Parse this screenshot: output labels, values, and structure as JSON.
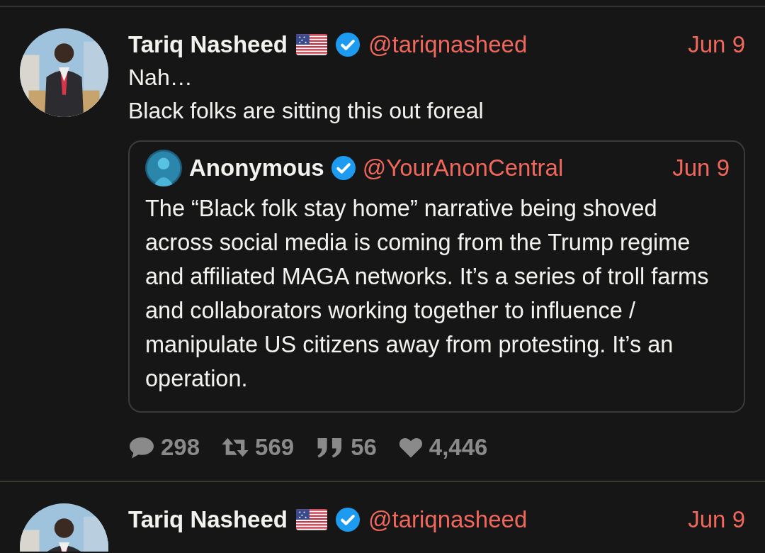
{
  "tweets": [
    {
      "author": {
        "name": "Tariq Nasheed",
        "flag": true,
        "verified": true,
        "handle": "@tariqnasheed"
      },
      "date": "Jun 9",
      "text": [
        "Nah…",
        "Black folks are sitting this out foreal"
      ],
      "quote": {
        "author": {
          "name": "Anonymous",
          "verified": true,
          "handle": "@YourAnonCentral"
        },
        "date": "Jun 9",
        "text": "The “Black folk stay home” narrative being shoved across social media is coming from the Trump regime and affiliated MAGA networks. It’s a series of troll farms and collaborators working together to influence / manipulate US citizens away from protesting. It’s an operation."
      },
      "stats": [
        {
          "kind": "reply",
          "count": "298"
        },
        {
          "kind": "retweet",
          "count": "569"
        },
        {
          "kind": "quote",
          "count": "56"
        },
        {
          "kind": "like",
          "count": "4,446"
        }
      ]
    },
    {
      "author": {
        "name": "Tariq Nasheed",
        "flag": true,
        "verified": true,
        "handle": "@tariqnasheed"
      },
      "date": "Jun 9"
    }
  ]
}
